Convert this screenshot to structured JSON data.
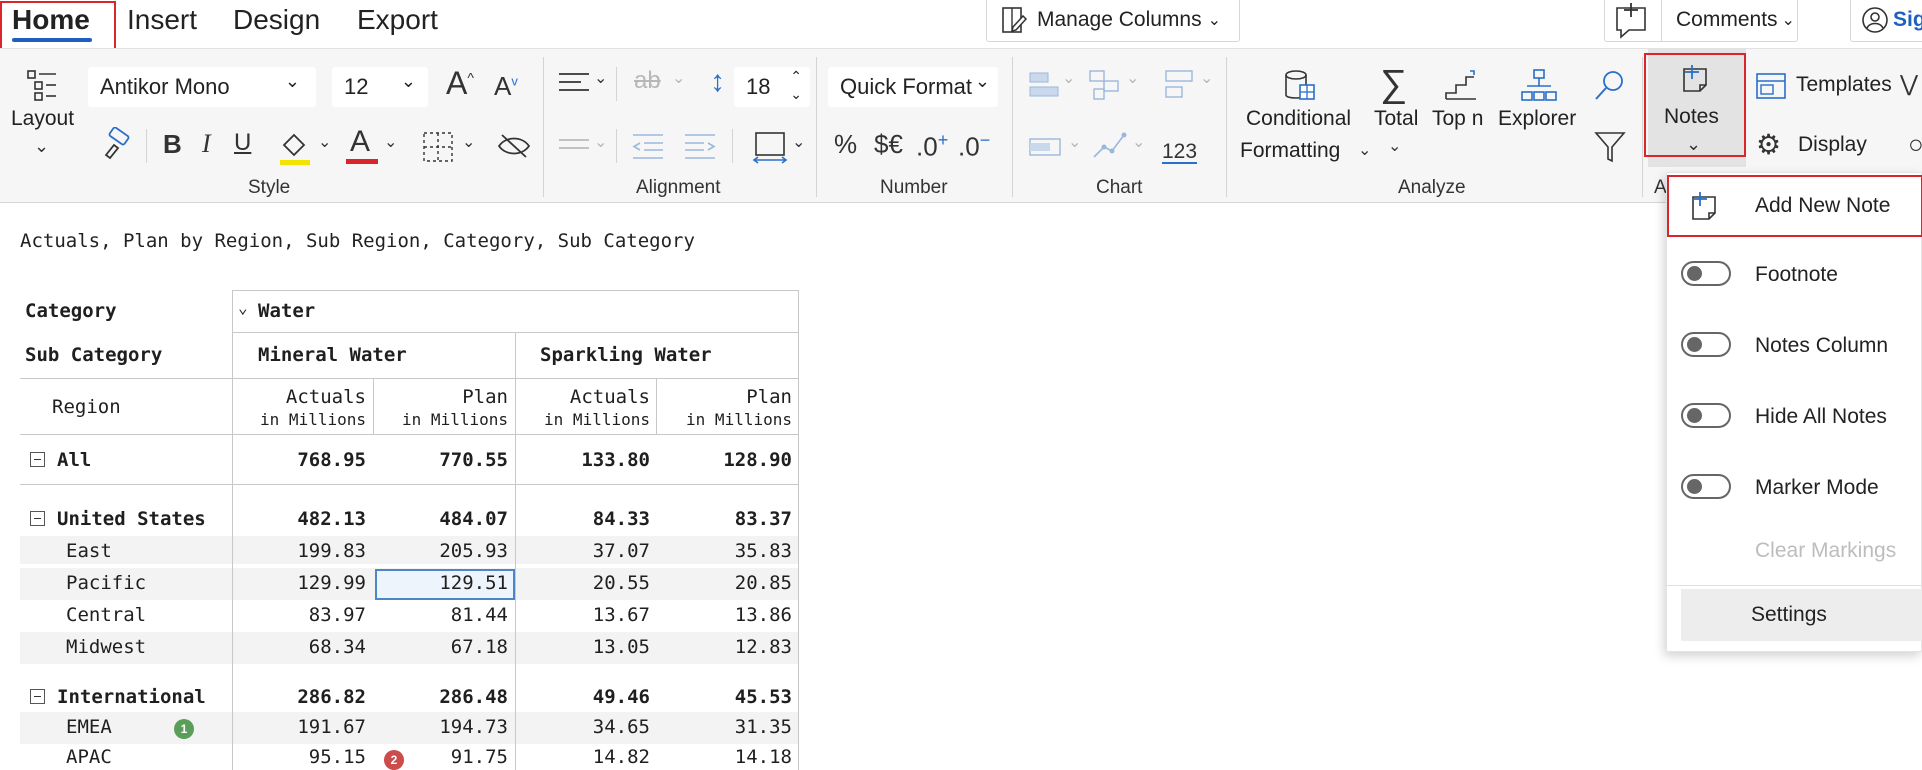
{
  "tabs": {
    "home": "Home",
    "insert": "Insert",
    "design": "Design",
    "export": "Export"
  },
  "topbar": {
    "manage_columns": "Manage Columns",
    "comments": "Comments",
    "sign_partial": "Sig"
  },
  "ribbon": {
    "layout_label": "Layout",
    "font_family": "Antikor Mono",
    "font_size": "12",
    "bold": "B",
    "italic": "I",
    "underline": "U",
    "line_height": "18",
    "quick_format": "Quick Format",
    "percent": "%",
    "currency": "$€",
    "number_123": "123",
    "conditional_formatting_1": "Conditional",
    "conditional_formatting_2": "Formatting",
    "total": "Total",
    "top_n": "Top n",
    "explorer": "Explorer",
    "notes": "Notes",
    "templates": "Templates",
    "display": "Display",
    "groups": {
      "style": "Style",
      "alignment": "Alignment",
      "number": "Number",
      "chart": "Chart",
      "analyze": "Analyze",
      "partial": "A"
    }
  },
  "report": {
    "subtitle": "Actuals, Plan by Region, Sub Region, Category, Sub Category",
    "headers": {
      "category": "Category",
      "sub_category": "Sub Category",
      "region": "Region",
      "water": "Water",
      "mineral_water": "Mineral Water",
      "sparkling_water": "Sparkling Water",
      "actuals": "Actuals",
      "plan": "Plan",
      "unit": "in Millions"
    },
    "rows": [
      {
        "label": "All",
        "values": [
          "768.95",
          "770.55",
          "133.80",
          "128.90"
        ]
      },
      {
        "label": "United States",
        "values": [
          "482.13",
          "484.07",
          "84.33",
          "83.37"
        ]
      },
      {
        "label": "East",
        "values": [
          "199.83",
          "205.93",
          "37.07",
          "35.83"
        ]
      },
      {
        "label": "Pacific",
        "values": [
          "129.99",
          "129.51",
          "20.55",
          "20.85"
        ]
      },
      {
        "label": "Central",
        "values": [
          "83.97",
          "81.44",
          "13.67",
          "13.86"
        ]
      },
      {
        "label": "Midwest",
        "values": [
          "68.34",
          "67.18",
          "13.05",
          "12.83"
        ]
      },
      {
        "label": "International",
        "values": [
          "286.82",
          "286.48",
          "49.46",
          "45.53"
        ]
      },
      {
        "label": "EMEA",
        "values": [
          "191.67",
          "194.73",
          "34.65",
          "31.35"
        ]
      },
      {
        "label": "APAC",
        "values": [
          "95.15",
          "91.75",
          "14.82",
          "14.18"
        ]
      }
    ],
    "badges": {
      "emea": "1",
      "apac": "2"
    }
  },
  "notes_menu": {
    "add_new_note": "Add New Note",
    "footnote": "Footnote",
    "notes_column": "Notes Column",
    "hide_all_notes": "Hide All Notes",
    "marker_mode": "Marker Mode",
    "clear_markings": "Clear Markings",
    "settings": "Settings"
  },
  "colors": {
    "accent_blue": "#1f5fbf",
    "highlight_red": "#d9262c",
    "badge_green": "#5a9e5a",
    "badge_red": "#cc4b4b",
    "disabled_text": "#bdbdbd"
  }
}
